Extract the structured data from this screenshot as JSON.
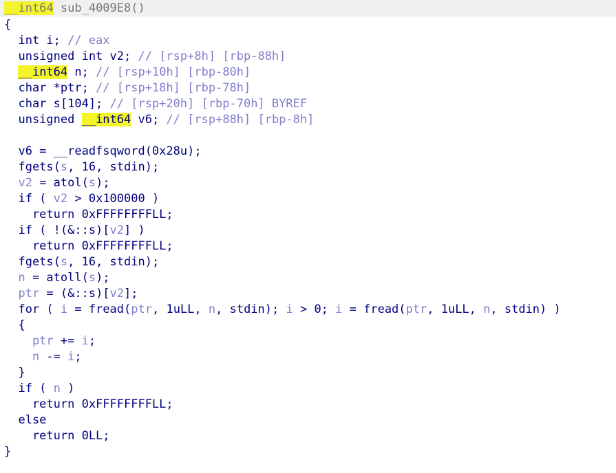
{
  "code": {
    "sig_type": "__int64",
    "sig_name": " sub_4009E8()",
    "open_brace": "{",
    "close_brace": "}",
    "decl": {
      "l1_code": "  int i; ",
      "l1_comment": "// eax",
      "l2_code": "  unsigned int v2; ",
      "l2_comment": "// [rsp+8h] [rbp-88h]",
      "l3_indent": "  ",
      "l3_type": "__int64",
      "l3_code": " n; ",
      "l3_comment": "// [rsp+10h] [rbp-80h]",
      "l4_code": "  char *ptr; ",
      "l4_comment": "// [rsp+18h] [rbp-78h]",
      "l5_code": "  char s[104]; ",
      "l5_comment": "// [rsp+20h] [rbp-70h] BYREF",
      "l6_code": "  unsigned ",
      "l6_type": "__int64",
      "l6_code2": " v6; ",
      "l6_comment": "// [rsp+88h] [rbp-8h]"
    },
    "body": {
      "b1_a": "  v6 = __readfsqword(0x28u);",
      "b2_a": "  fgets(",
      "b2_v": "s",
      "b2_b": ", 16, stdin);",
      "b3_v": "  v2",
      "b3_a": " = atol(",
      "b3_v2": "s",
      "b3_b": ");",
      "b4_a": "  if ( ",
      "b4_v": "v2",
      "b4_b": " > 0x100000 )",
      "b5_a": "    return 0xFFFFFFFFLL;",
      "b6_a": "  if ( !(&::s)[",
      "b6_v": "v2",
      "b6_b": "] )",
      "b7_a": "    return 0xFFFFFFFFLL;",
      "b8_a": "  fgets(",
      "b8_v": "s",
      "b8_b": ", 16, stdin);",
      "b9_v": "  n",
      "b9_a": " = atoll(",
      "b9_v2": "s",
      "b9_b": ");",
      "b10_v": "  ptr",
      "b10_a": " = (&::s)[",
      "b10_v2": "v2",
      "b10_b": "];",
      "b11_a": "  for ( ",
      "b11_v1": "i",
      "b11_b": " = fread(",
      "b11_v2": "ptr",
      "b11_c": ", 1uLL, ",
      "b11_v3": "n",
      "b11_d": ", stdin); ",
      "b11_v4": "i",
      "b11_e": " > 0; ",
      "b11_v5": "i",
      "b11_f": " = fread(",
      "b11_v6": "ptr",
      "b11_g": ", 1uLL, ",
      "b11_v7": "n",
      "b11_h": ", stdin) )",
      "b12_a": "  {",
      "b13_v": "    ptr",
      "b13_a": " += ",
      "b13_v2": "i",
      "b13_b": ";",
      "b14_v": "    n",
      "b14_a": " -= ",
      "b14_v2": "i",
      "b14_b": ";",
      "b15_a": "  }",
      "b16_a": "  if ( ",
      "b16_v": "n",
      "b16_b": " )",
      "b17_a": "    return 0xFFFFFFFFLL;",
      "b18_a": "  else",
      "b19_a": "    return 0LL;"
    }
  },
  "colors": {
    "keyword_text": "#000080",
    "variable_text": "#7f7fcc",
    "highlight": "#f4f42a",
    "signature_bar": "#f0f0f0"
  }
}
